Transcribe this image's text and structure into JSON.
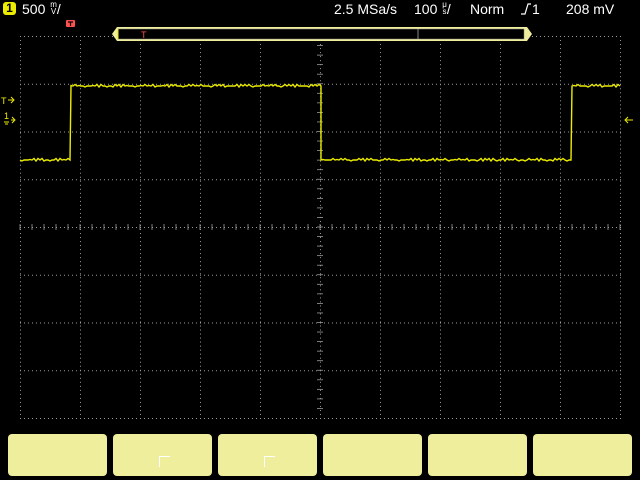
{
  "status": {
    "channel_number": "1",
    "volts_per_div_value": "500",
    "volts_per_div_unit_top": "m",
    "volts_per_div_unit_bottom": "V",
    "volts_per_div_suffix": "/",
    "sample_rate": "2.5 MSa/s",
    "time_per_div_value": "100",
    "time_per_div_unit_top": "μ",
    "time_per_div_unit_bottom": "s",
    "time_per_div_suffix": "/",
    "trigger_mode": "Norm",
    "trigger_slope_icon": "rising-edge-icon",
    "trigger_source": "1",
    "trigger_level": "208 mV"
  },
  "screen": {
    "trigger_marker": "T",
    "left_trigger_marker": "T",
    "left_ground_marker": "1",
    "colors": {
      "trace": "#ecec00",
      "grid": "#9a9a9a",
      "softkey": "#eeee9c",
      "marker": "#ff5050"
    }
  },
  "trace": {
    "levels": [
      "low",
      "high",
      "low",
      "high"
    ]
  },
  "softkeys": [
    {
      "label": ""
    },
    {
      "label": ""
    },
    {
      "label": ""
    },
    {
      "label": ""
    },
    {
      "label": ""
    },
    {
      "label": ""
    }
  ]
}
